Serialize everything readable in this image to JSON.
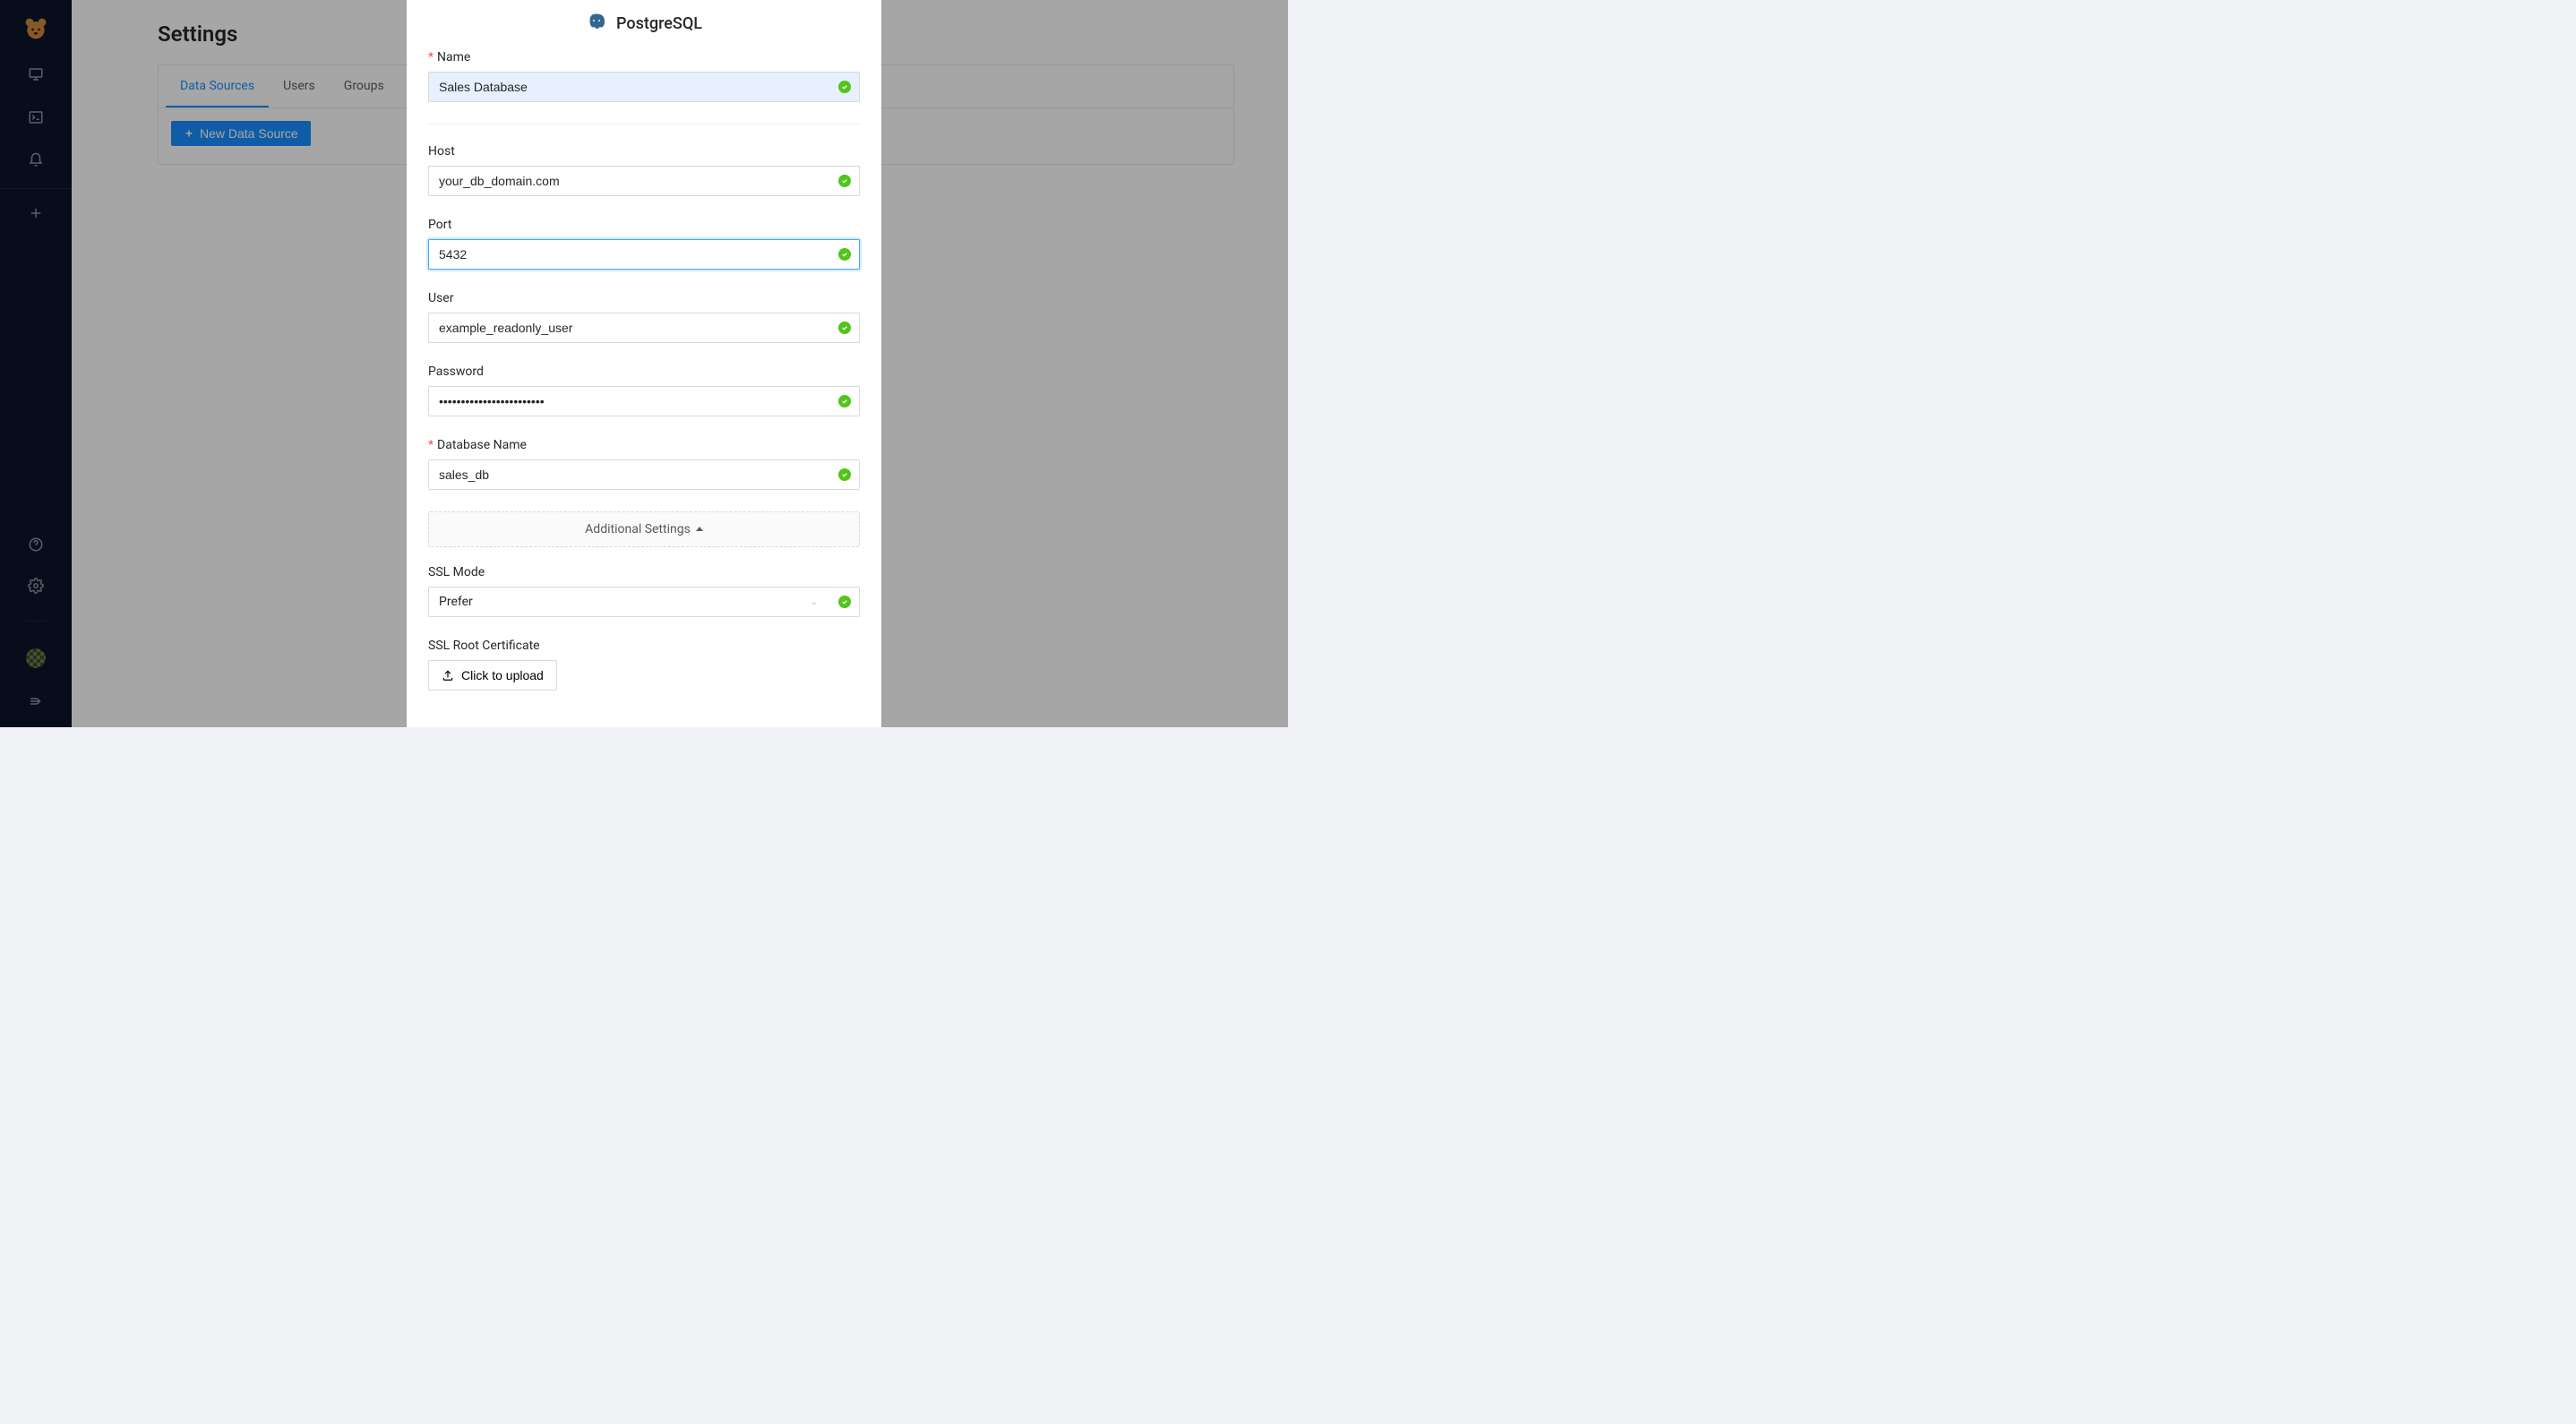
{
  "page": {
    "title": "Settings",
    "tabs": [
      {
        "label": "Data Sources",
        "active": true
      },
      {
        "label": "Users",
        "active": false
      },
      {
        "label": "Groups",
        "active": false
      }
    ],
    "new_data_source_label": "New Data Source"
  },
  "modal": {
    "title": "PostgreSQL",
    "fields": {
      "name": {
        "label": "Name",
        "value": "Sales Database",
        "required": true
      },
      "host": {
        "label": "Host",
        "value": "your_db_domain.com"
      },
      "port": {
        "label": "Port",
        "value": "5432",
        "focused": true
      },
      "user": {
        "label": "User",
        "value": "example_readonly_user"
      },
      "password": {
        "label": "Password",
        "value": "••••••••••••••••••••••••"
      },
      "database_name": {
        "label": "Database Name",
        "value": "sales_db",
        "required": true
      },
      "ssl_mode": {
        "label": "SSL Mode",
        "value": "Prefer"
      },
      "ssl_root_cert": {
        "label": "SSL Root Certificate",
        "upload_label": "Click to upload"
      }
    },
    "additional_settings_label": "Additional Settings"
  },
  "sidebar": {
    "logo_icon": "bear-face-icon",
    "top_items": [
      "monitor-icon",
      "terminal-icon",
      "bell-icon"
    ],
    "add_icon": "plus-icon",
    "bottom_items": [
      "help-icon",
      "gear-icon"
    ],
    "avatar": "avatar-icon",
    "collapse_icon": "collapse-icon"
  }
}
